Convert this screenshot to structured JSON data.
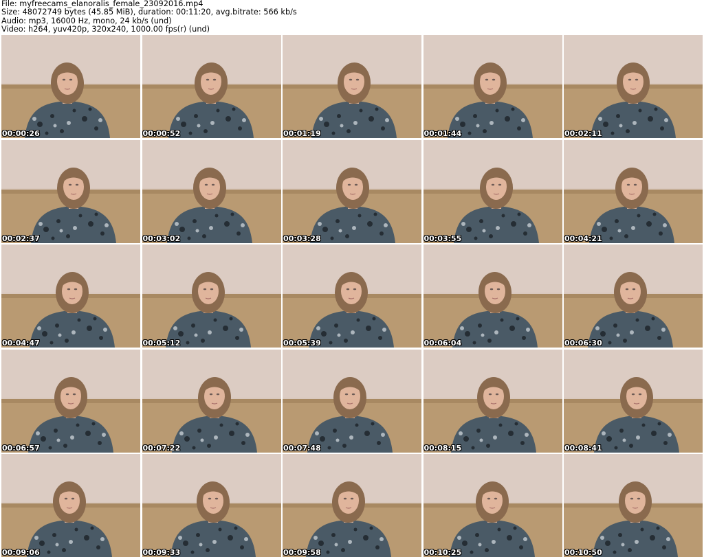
{
  "header": {
    "file_line": "File: myfreecams_elanoralis_female_23092016.mp4",
    "size_line": "Size: 48072749 bytes (45.85 MiB), duration: 00:11:20, avg.bitrate: 566 kb/s",
    "audio_line": "Audio: mp3, 16000 Hz, mono, 24 kb/s (und)",
    "video_line": "Video: h264, yuv420p, 320x240, 1000.00 fps(r) (und)"
  },
  "thumbnails": [
    {
      "timestamp": "00:00:26"
    },
    {
      "timestamp": "00:00:52"
    },
    {
      "timestamp": "00:01:19"
    },
    {
      "timestamp": "00:01:44"
    },
    {
      "timestamp": "00:02:11"
    },
    {
      "timestamp": "00:02:37"
    },
    {
      "timestamp": "00:03:02"
    },
    {
      "timestamp": "00:03:28"
    },
    {
      "timestamp": "00:03:55"
    },
    {
      "timestamp": "00:04:21"
    },
    {
      "timestamp": "00:04:47"
    },
    {
      "timestamp": "00:05:12"
    },
    {
      "timestamp": "00:05:39"
    },
    {
      "timestamp": "00:06:04"
    },
    {
      "timestamp": "00:06:30"
    },
    {
      "timestamp": "00:06:57"
    },
    {
      "timestamp": "00:07:22"
    },
    {
      "timestamp": "00:07:48"
    },
    {
      "timestamp": "00:08:15"
    },
    {
      "timestamp": "00:08:41"
    },
    {
      "timestamp": "00:09:06"
    },
    {
      "timestamp": "00:09:33"
    },
    {
      "timestamp": "00:09:58"
    },
    {
      "timestamp": "00:10:25"
    },
    {
      "timestamp": "00:10:50"
    }
  ],
  "colors": {
    "wallpaper": "#d9c8bd",
    "sofa": "#b99a72",
    "hair": "#8a6a4e",
    "skin": "#e0b59c",
    "top": "#4a5a66",
    "timestamp_text": "#ffffff"
  }
}
